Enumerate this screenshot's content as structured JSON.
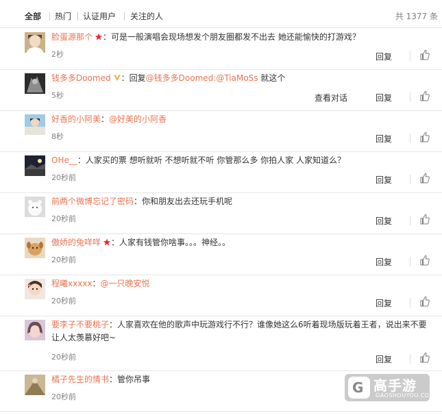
{
  "tabs": {
    "all": "全部",
    "hot": "热门",
    "verified": "认证用户",
    "following": "关注的人"
  },
  "total": "共 1377 条",
  "actions": {
    "reply": "回复",
    "view_conversation": "查看对话"
  },
  "colors": {
    "name_link": "#eb7350",
    "star": "#e8262b",
    "muted": "#808080",
    "divider": "#e6e6e6"
  },
  "comments": [
    {
      "user": "脸蛋源那个",
      "badge": "star-icon",
      "sep": "：",
      "text": "可是一般演唱会现场想发个朋友圈都发不出去 她还能愉快的打游戏？",
      "time": "2秒"
    },
    {
      "user": "钱多多Doomed",
      "badge": "vip-v-icon",
      "sep": "：",
      "text": "回复",
      "mention": "@钱多多Doomed:@TiaMoSs",
      "text_after": " 就这个",
      "time": "5秒",
      "extra": "查看对话"
    },
    {
      "user": "好香的小阿美",
      "sep": "：",
      "mention": "@好美的小阿香",
      "time": "8秒"
    },
    {
      "user": "OHe__",
      "sep": "：",
      "text": "人家买的票 想听就听 不想听就不听 你管那么多 你拍人家 人家知道么？",
      "time": "20秒前"
    },
    {
      "user": "前两个微博忘记了密码",
      "sep": "：",
      "text": "你和朋友出去还玩手机呢",
      "time": "20秒前"
    },
    {
      "user": "傲娇的兔咩咩",
      "badge": "star-icon",
      "sep": "：",
      "text": "人家有钱管你啥事。。。神经。。",
      "time": "20秒前"
    },
    {
      "user": "程曦xxxxx",
      "sep": "：",
      "mention": "@一只晚安悦",
      "time": "20秒前"
    },
    {
      "user": "要李子不要桃子",
      "sep": "：",
      "text": "人家喜欢在他的歌声中玩游戏行不行？谁像她这么6听着现场版玩着王者，说出来不要让人太羡慕好吧~",
      "time": "20秒前"
    },
    {
      "user": "橘子先生的情书",
      "sep": "：",
      "text": "管你吊事",
      "time": "20秒前"
    }
  ],
  "watermark": {
    "name": "高手游",
    "url": "GAOSHOUYOU.COM",
    "mark": "G"
  }
}
